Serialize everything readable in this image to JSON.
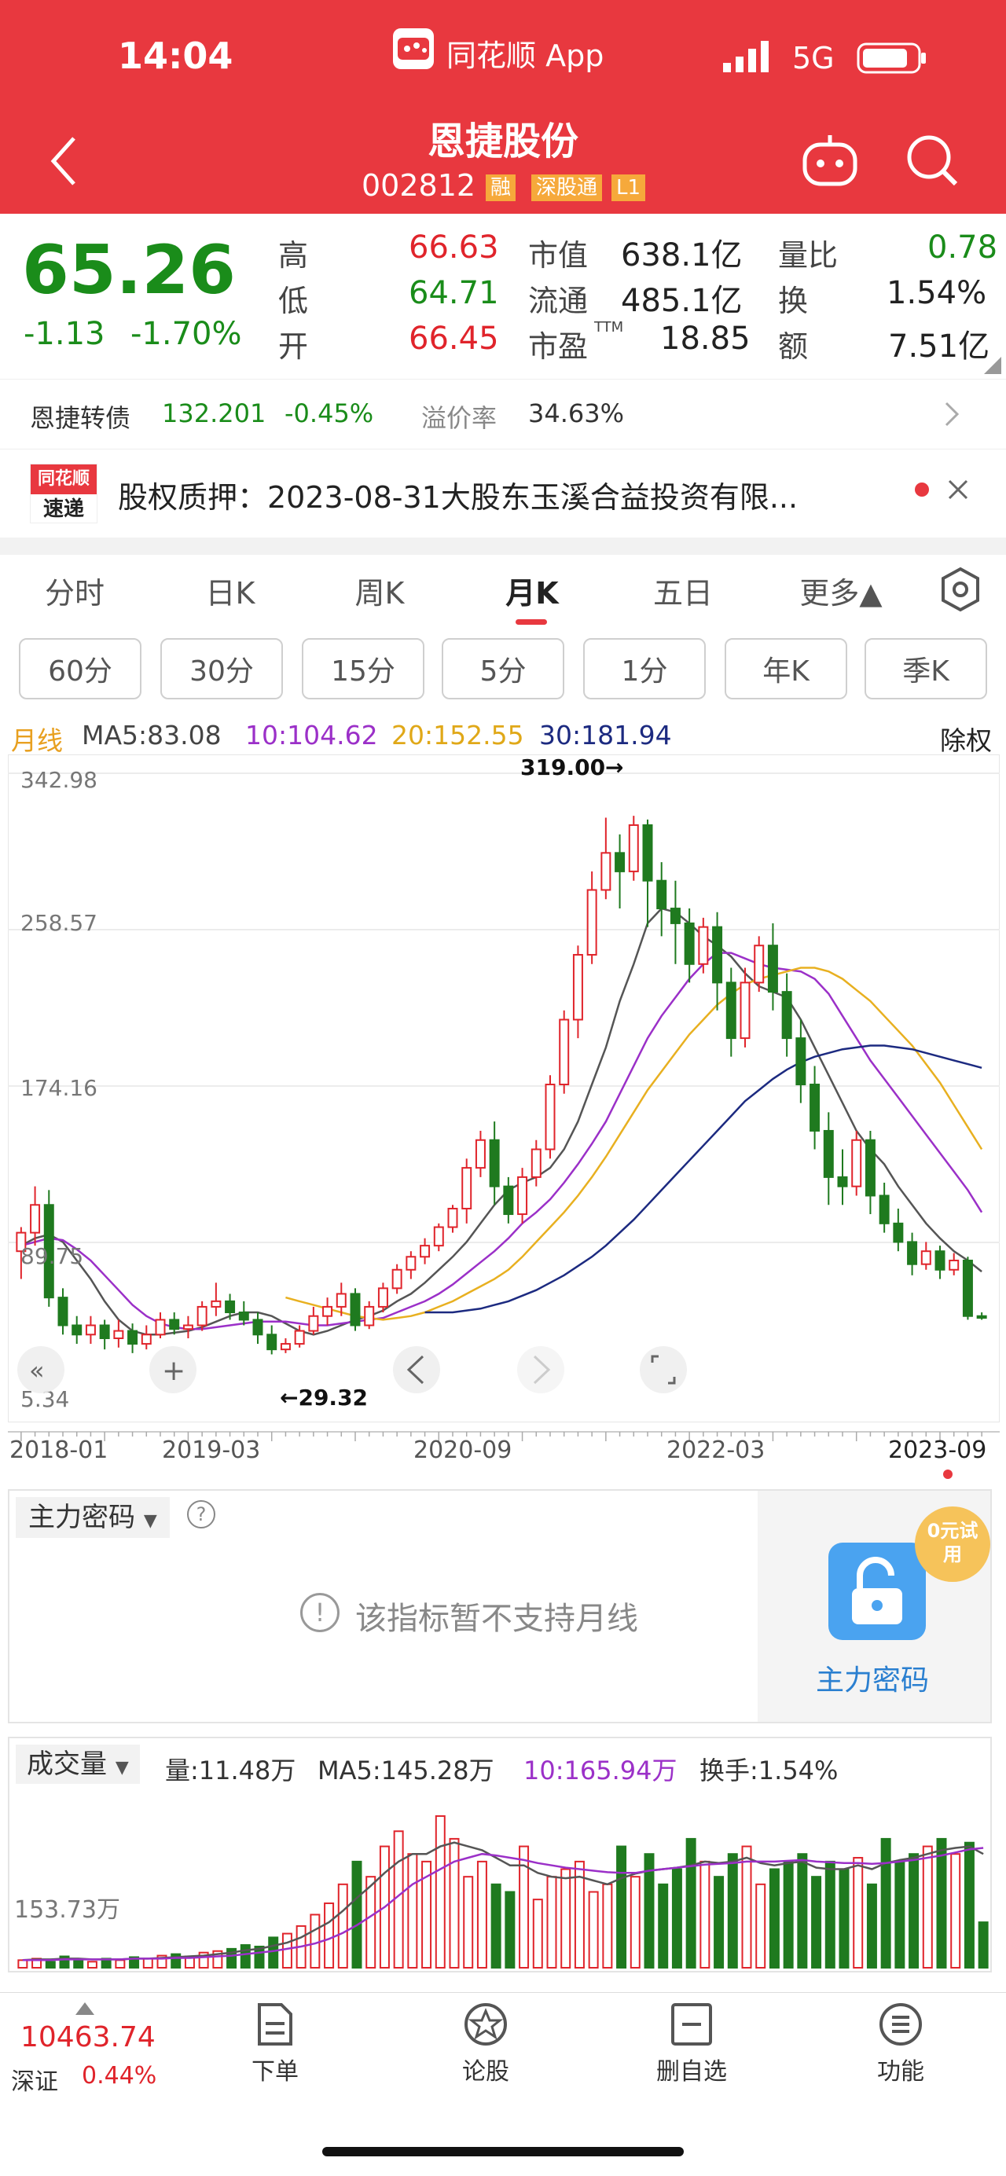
{
  "status_bar": {
    "time": "14:04",
    "app_name": "同花顺 App",
    "network": "5G"
  },
  "header": {
    "title": "恩捷股份",
    "code": "002812",
    "badges": [
      "融",
      "深股通",
      "L1"
    ]
  },
  "quote": {
    "price": "65.26",
    "change": "-1.13",
    "change_pct": "-1.70%",
    "high_label": "高",
    "high": "66.63",
    "low_label": "低",
    "low": "64.71",
    "open_label": "开",
    "open": "66.45",
    "mktcap_label": "市值",
    "mktcap": "638.1亿",
    "float_label": "流通",
    "float": "485.1亿",
    "pe_label": "市盈",
    "pe_sup": "TTM",
    "pe": "18.85",
    "vol_ratio_label": "量比",
    "vol_ratio": "0.78",
    "turnover_label": "换",
    "turnover": "1.54%",
    "amount_label": "额",
    "amount": "7.51亿"
  },
  "convertible": {
    "name": "恩捷转债",
    "price": "132.201",
    "change": "-0.45%",
    "premium_label": "溢价率",
    "premium": "34.63%"
  },
  "news": {
    "logo_top": "同花顺",
    "logo_bottom": "速递",
    "text": "股权质押：2023-08-31大股东玉溪合益投资有限..."
  },
  "tabs": [
    "分时",
    "日K",
    "周K",
    "月K",
    "五日",
    "更多▲"
  ],
  "active_tab": "月K",
  "intervals": [
    "60分",
    "30分",
    "15分",
    "5分",
    "1分",
    "年K",
    "季K"
  ],
  "ma_legend": {
    "label": "月线",
    "ma5": "MA5:83.08",
    "ma10": "10:104.62",
    "ma20": "20:152.55",
    "ma30": "30:181.94",
    "rights": "除权"
  },
  "colors": {
    "up": "#e0242b",
    "down": "#1f7a1f",
    "ma5": "#555555",
    "ma10": "#9b30c8",
    "ma20": "#e8b020",
    "ma30": "#1c2a80",
    "brand": "#e8383f"
  },
  "chart_data": [
    {
      "type": "candlestick",
      "title": "",
      "ylabels": [
        "342.98",
        "258.57",
        "174.16",
        "89.75",
        "5.34"
      ],
      "ylim": [
        5.34,
        342.98
      ],
      "xlabels": [
        "2018-01",
        "2019-03",
        "2020-09",
        "2022-03",
        "2023-09"
      ],
      "annotations": {
        "max": "319.00→",
        "min": "←29.32"
      },
      "candles": [
        [
          85,
          95,
          70,
          98
        ],
        [
          95,
          110,
          88,
          120
        ],
        [
          110,
          60,
          55,
          118
        ],
        [
          60,
          45,
          40,
          65
        ],
        [
          45,
          40,
          35,
          50
        ],
        [
          40,
          45,
          35,
          50
        ],
        [
          45,
          38,
          32,
          48
        ],
        [
          38,
          42,
          33,
          48
        ],
        [
          42,
          35,
          30,
          46
        ],
        [
          35,
          40,
          32,
          45
        ],
        [
          40,
          48,
          38,
          52
        ],
        [
          48,
          43,
          40,
          52
        ],
        [
          43,
          45,
          38,
          50
        ],
        [
          45,
          55,
          42,
          58
        ],
        [
          55,
          58,
          50,
          68
        ],
        [
          58,
          52,
          48,
          62
        ],
        [
          52,
          48,
          45,
          58
        ],
        [
          48,
          40,
          35,
          52
        ],
        [
          40,
          32,
          29.32,
          45
        ],
        [
          32,
          35,
          30,
          38
        ],
        [
          35,
          42,
          33,
          45
        ],
        [
          42,
          50,
          40,
          55
        ],
        [
          50,
          55,
          45,
          60
        ],
        [
          55,
          62,
          50,
          68
        ],
        [
          62,
          45,
          42,
          65
        ],
        [
          45,
          55,
          43,
          58
        ],
        [
          55,
          65,
          52,
          68
        ],
        [
          65,
          75,
          62,
          78
        ],
        [
          75,
          82,
          70,
          85
        ],
        [
          82,
          88,
          78,
          92
        ],
        [
          88,
          98,
          85,
          100
        ],
        [
          98,
          108,
          95,
          110
        ],
        [
          108,
          130,
          100,
          135
        ],
        [
          130,
          145,
          125,
          150
        ],
        [
          145,
          120,
          110,
          155
        ],
        [
          120,
          105,
          100,
          125
        ],
        [
          105,
          125,
          100,
          130
        ],
        [
          125,
          140,
          120,
          145
        ],
        [
          140,
          175,
          135,
          180
        ],
        [
          175,
          210,
          170,
          215
        ],
        [
          210,
          245,
          200,
          250
        ],
        [
          245,
          280,
          240,
          290
        ],
        [
          280,
          300,
          275,
          319
        ],
        [
          300,
          290,
          270,
          310
        ],
        [
          290,
          315,
          285,
          320
        ],
        [
          315,
          285,
          260,
          318
        ],
        [
          285,
          270,
          255,
          295
        ],
        [
          270,
          262,
          240,
          285
        ],
        [
          262,
          240,
          230,
          270
        ],
        [
          240,
          260,
          235,
          265
        ],
        [
          260,
          230,
          215,
          268
        ],
        [
          230,
          200,
          190,
          238
        ],
        [
          200,
          230,
          195,
          238
        ],
        [
          230,
          250,
          225,
          255
        ],
        [
          250,
          225,
          215,
          262
        ],
        [
          225,
          200,
          190,
          235
        ],
        [
          200,
          175,
          165,
          210
        ],
        [
          175,
          150,
          140,
          185
        ],
        [
          150,
          125,
          110,
          160
        ],
        [
          125,
          120,
          110,
          140
        ],
        [
          120,
          145,
          115,
          150
        ],
        [
          145,
          115,
          105,
          150
        ],
        [
          115,
          100,
          95,
          122
        ],
        [
          100,
          90,
          85,
          108
        ],
        [
          90,
          78,
          72,
          95
        ],
        [
          78,
          85,
          75,
          90
        ],
        [
          85,
          75,
          70,
          88
        ],
        [
          75,
          80,
          72,
          84
        ],
        [
          80,
          50,
          48,
          82
        ],
        [
          50,
          49,
          48,
          52
        ]
      ],
      "ma5": [
        88,
        92,
        94,
        90,
        80,
        70,
        58,
        48,
        42,
        40,
        40,
        41,
        42,
        44,
        47,
        50,
        52,
        52,
        50,
        46,
        42,
        40,
        42,
        45,
        48,
        50,
        53,
        58,
        62,
        68,
        75,
        82,
        90,
        100,
        110,
        118,
        122,
        125,
        130,
        140,
        155,
        175,
        195,
        220,
        240,
        262,
        270,
        268,
        262,
        255,
        250,
        244,
        235,
        228,
        225,
        222,
        210,
        195,
        180,
        165,
        150,
        140,
        132,
        120,
        110,
        100,
        92,
        85,
        80,
        74
      ],
      "ma10": [
        88,
        90,
        92,
        91,
        86,
        80,
        72,
        64,
        56,
        50,
        46,
        44,
        43,
        43,
        44,
        45,
        46,
        47,
        47,
        47,
        46,
        45,
        45,
        46,
        47,
        48,
        49,
        52,
        55,
        58,
        62,
        67,
        73,
        79,
        85,
        92,
        100,
        106,
        113,
        122,
        132,
        143,
        155,
        170,
        185,
        200,
        212,
        222,
        232,
        240,
        246,
        246,
        243,
        240,
        238,
        237,
        236,
        232,
        224,
        212,
        200,
        188,
        178,
        168,
        158,
        148,
        138,
        128,
        118,
        106
      ],
      "ma20": [
        null,
        null,
        null,
        null,
        null,
        null,
        null,
        null,
        null,
        null,
        null,
        null,
        null,
        null,
        null,
        null,
        null,
        null,
        null,
        60,
        58,
        56,
        54,
        52,
        50,
        49,
        48,
        49,
        50,
        52,
        55,
        58,
        62,
        66,
        70,
        75,
        82,
        90,
        98,
        106,
        115,
        125,
        136,
        148,
        160,
        172,
        182,
        192,
        202,
        210,
        218,
        224,
        229,
        232,
        234,
        236,
        238,
        238,
        236,
        232,
        226,
        220,
        212,
        204,
        196,
        186,
        176,
        164,
        152,
        140
      ],
      "ma30": [
        null,
        null,
        null,
        null,
        null,
        null,
        null,
        null,
        null,
        null,
        null,
        null,
        null,
        null,
        null,
        null,
        null,
        null,
        null,
        null,
        null,
        null,
        null,
        null,
        null,
        null,
        null,
        null,
        null,
        52,
        52,
        52,
        53,
        54,
        56,
        58,
        61,
        64,
        68,
        72,
        77,
        82,
        88,
        95,
        102,
        110,
        118,
        126,
        134,
        142,
        150,
        158,
        166,
        172,
        178,
        183,
        187,
        190,
        192,
        194,
        195,
        196,
        196,
        195,
        194,
        192,
        190,
        188,
        186,
        184
      ]
    },
    {
      "type": "bar",
      "title": "",
      "ylabels": [
        "153.73万"
      ],
      "volumes": [
        10,
        12,
        8,
        15,
        10,
        8,
        12,
        10,
        14,
        12,
        16,
        18,
        15,
        20,
        22,
        25,
        30,
        28,
        40,
        45,
        55,
        70,
        85,
        110,
        140,
        120,
        160,
        180,
        150,
        140,
        200,
        170,
        120,
        140,
        110,
        100,
        160,
        90,
        120,
        130,
        140,
        100,
        110,
        160,
        120,
        150,
        110,
        130,
        170,
        140,
        120,
        150,
        160,
        110,
        130,
        140,
        150,
        120,
        140,
        130,
        145,
        110,
        170,
        140,
        150,
        160,
        170,
        150,
        165,
        60
      ],
      "vol_ma5": [
        10,
        11,
        11,
        12,
        12,
        11,
        11,
        11,
        12,
        12,
        13,
        14,
        15,
        16,
        18,
        20,
        23,
        25,
        29,
        33,
        40,
        50,
        60,
        75,
        92,
        108,
        125,
        140,
        150,
        150,
        160,
        165,
        160,
        155,
        145,
        135,
        135,
        125,
        120,
        118,
        120,
        115,
        110,
        118,
        124,
        128,
        130,
        132,
        135,
        140,
        138,
        140,
        145,
        138,
        135,
        138,
        140,
        132,
        130,
        130,
        135,
        130,
        138,
        142,
        145,
        150,
        155,
        158,
        160,
        150
      ],
      "vol_ma10": [
        10,
        10,
        10,
        11,
        11,
        11,
        11,
        11,
        12,
        12,
        12,
        13,
        13,
        14,
        15,
        16,
        18,
        20,
        22,
        25,
        28,
        32,
        38,
        46,
        56,
        68,
        80,
        95,
        110,
        120,
        130,
        140,
        145,
        150,
        148,
        145,
        142,
        138,
        135,
        132,
        130,
        128,
        126,
        125,
        125,
        128,
        130,
        132,
        134,
        136,
        137,
        138,
        140,
        140,
        140,
        141,
        142,
        140,
        139,
        138,
        138,
        137,
        138,
        140,
        142,
        145,
        148,
        152,
        156,
        158
      ]
    }
  ],
  "indicator1": {
    "name": "主力密码",
    "notice": "该指标暂不支持月线",
    "promo": "主力密码",
    "promo_badge": "0元试用"
  },
  "indicator2": {
    "name": "成交量",
    "vol": "量:11.48万",
    "ma5": "MA5:145.28万",
    "ma10": "10:165.94万",
    "turnover": "换手:1.54%"
  },
  "bottom_nav": {
    "index_value": "10463.74",
    "index_name": "深证",
    "index_pct": "0.44%",
    "items": [
      "下单",
      "论股",
      "删自选",
      "功能"
    ]
  }
}
